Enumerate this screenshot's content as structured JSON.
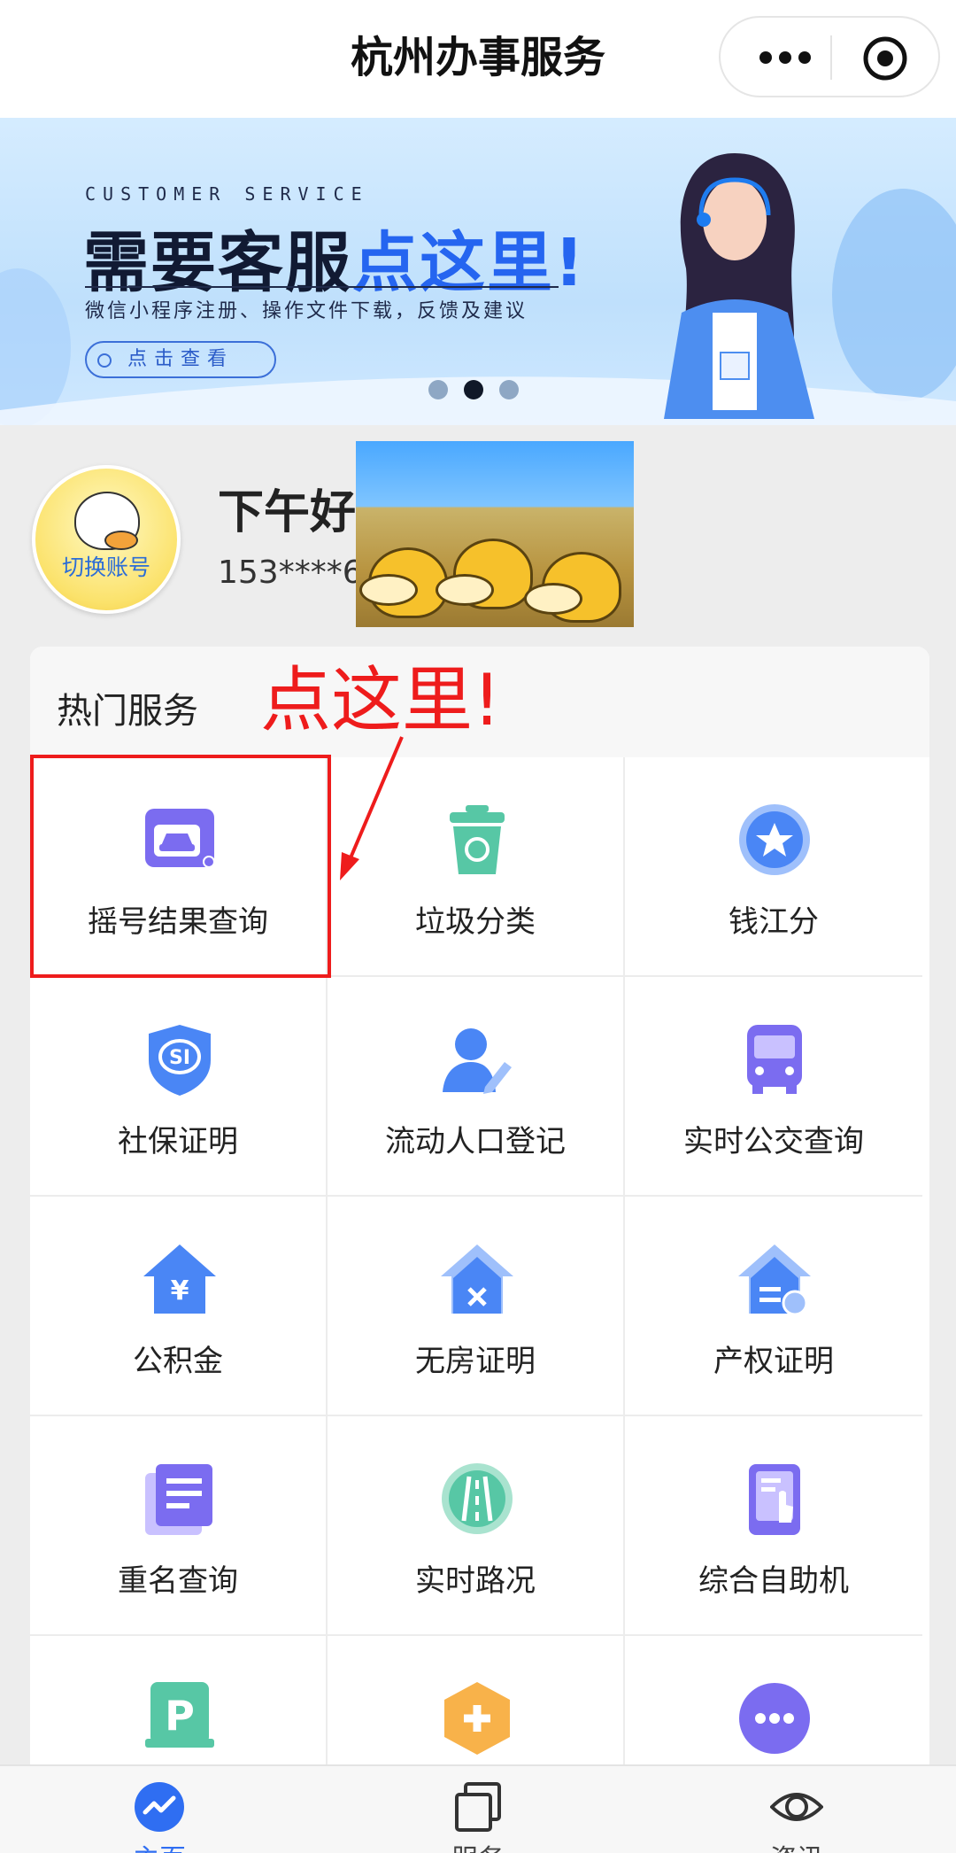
{
  "nav": {
    "title": "杭州办事服务"
  },
  "banner": {
    "kicker": "CUSTOMER SERVICE",
    "headline_plain": "需要客服",
    "headline_highlight": "点这里!",
    "subtitle": "微信小程序注册、操作文件下载，反馈及建议",
    "button_label": "点击查看",
    "dots": {
      "count": 3,
      "active_index": 1
    }
  },
  "profile": {
    "switch_account": "切换账号",
    "greeting": "下午好",
    "phone_masked": "153****6"
  },
  "services": {
    "title": "热门服务",
    "annotation": "点这里!",
    "items": [
      {
        "label": "摇号结果查询",
        "icon": "car-lottery-icon"
      },
      {
        "label": "垃圾分类",
        "icon": "recycle-bin-icon"
      },
      {
        "label": "钱江分",
        "icon": "star-badge-icon"
      },
      {
        "label": "社保证明",
        "icon": "social-security-shield-icon"
      },
      {
        "label": "流动人口登记",
        "icon": "person-edit-icon"
      },
      {
        "label": "实时公交查询",
        "icon": "bus-icon"
      },
      {
        "label": "公积金",
        "icon": "house-fund-icon"
      },
      {
        "label": "无房证明",
        "icon": "house-x-icon"
      },
      {
        "label": "产权证明",
        "icon": "property-certificate-icon"
      },
      {
        "label": "重名查询",
        "icon": "document-list-icon"
      },
      {
        "label": "实时路况",
        "icon": "road-icon"
      },
      {
        "label": "综合自助机",
        "icon": "kiosk-icon"
      },
      {
        "label": "",
        "icon": "parking-icon"
      },
      {
        "label": "",
        "icon": "medical-hexagon-icon"
      },
      {
        "label": "",
        "icon": "more-services-icon"
      }
    ]
  },
  "tabbar": {
    "items": [
      {
        "label": "主页",
        "icon": "home-trend-icon",
        "active": true
      },
      {
        "label": "服务",
        "icon": "service-cards-icon",
        "active": false
      },
      {
        "label": "资讯",
        "icon": "news-eye-icon",
        "active": false
      }
    ]
  },
  "colors": {
    "accent": "#2f6ef2",
    "annotation_red": "#ee1c1c",
    "icon_purple": "#7b6cf0",
    "icon_green": "#57c7a5",
    "icon_blue": "#4a86f5"
  }
}
